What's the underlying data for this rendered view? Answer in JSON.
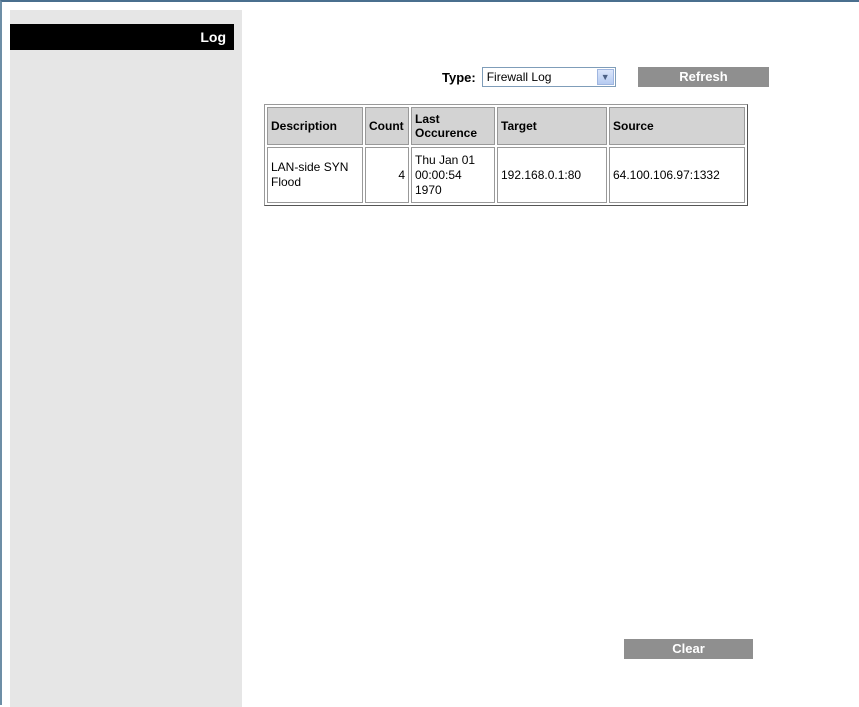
{
  "section": {
    "title": "Log"
  },
  "filter": {
    "type_label": "Type:",
    "type_value": "Firewall Log",
    "refresh_label": "Refresh"
  },
  "table": {
    "headers": {
      "description": "Description",
      "count": "Count",
      "last_occurence": "Last Occurence",
      "target": "Target",
      "source": "Source"
    },
    "rows": [
      {
        "description": "LAN-side SYN Flood",
        "count": "4",
        "last_occurence": "Thu Jan 01 00:00:54 1970",
        "target": "192.168.0.1:80",
        "source": "64.100.106.97:1332"
      }
    ]
  },
  "actions": {
    "clear_label": "Clear"
  },
  "colors": {
    "header_bg": "#000000",
    "sidebar_bg": "#e6e6e6",
    "button_bg": "#8f8f8f",
    "table_header_bg": "#d3d3d3"
  },
  "icons": {
    "dropdown": "chevron-down-icon"
  }
}
